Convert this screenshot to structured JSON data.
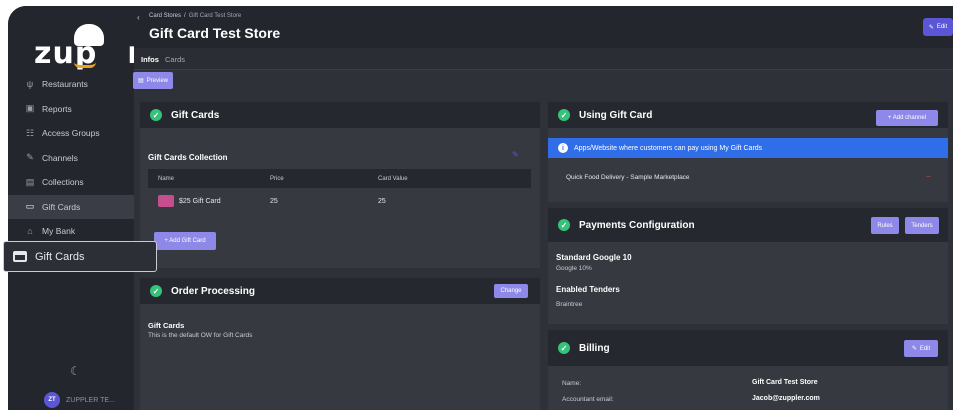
{
  "brand": {
    "logo_text_left": "zup",
    "logo_text_right": "r"
  },
  "sidebar": {
    "items": [
      {
        "label": "Restaurants",
        "icon": "fork-knife-icon"
      },
      {
        "label": "Reports",
        "icon": "report-icon"
      },
      {
        "label": "Access Groups",
        "icon": "users-icon"
      },
      {
        "label": "Channels",
        "icon": "channel-icon"
      },
      {
        "label": "Collections",
        "icon": "collection-icon"
      },
      {
        "label": "Gift Cards",
        "icon": "card-icon",
        "active": true
      },
      {
        "label": "My Bank",
        "icon": "bank-icon"
      }
    ],
    "user_initials": "ZT",
    "user_name": "ZUPPLER TE..."
  },
  "tooltip": {
    "label": "Gift Cards"
  },
  "header": {
    "breadcrumb_root": "Card Stores",
    "breadcrumb_sep": "/",
    "breadcrumb_current": "Gift Card Test Store",
    "title": "Gift Card Test Store",
    "edit_label": "Edit"
  },
  "tabs": [
    {
      "label": "Infos"
    },
    {
      "label": "Cards"
    }
  ],
  "preview_label": "Preview",
  "gift_cards": {
    "title": "Gift Cards",
    "collection_title": "Gift Cards Collection",
    "columns": [
      "Name",
      "Price",
      "Card Value"
    ],
    "rows": [
      {
        "name": "$25 Gift Card",
        "price": "25",
        "card_value": "25"
      }
    ],
    "add_label": "+ Add Gift Card"
  },
  "order_processing": {
    "title": "Order Processing",
    "change_label": "Change",
    "ow_title": "Gift Cards",
    "ow_desc": "This is the default OW for Gift Cards"
  },
  "using_gift_card": {
    "title": "Using Gift Card",
    "add_channel_label": "+ Add channel",
    "info_text": "Apps/Website where customers can pay using My Gift Cards",
    "channel": "Quick Food Delivery - Sample Marketplace"
  },
  "payments": {
    "title": "Payments Configuration",
    "rules_label": "Rules",
    "tenders_label": "Tenders",
    "rule_title": "Standard Google 10",
    "rule_sub": "Google 10%",
    "tenders_title": "Enabled Tenders",
    "tenders_sub": "Braintree"
  },
  "billing": {
    "title": "Billing",
    "edit_label": "Edit",
    "name_label": "Name:",
    "name_value": "Gift Card Test Store",
    "email_label": "Accountant email:",
    "email_value": "Jacob@zuppler.com"
  },
  "colors": {
    "accent": "#5b56d6",
    "success": "#35c37a",
    "info": "#2f6ee8"
  }
}
